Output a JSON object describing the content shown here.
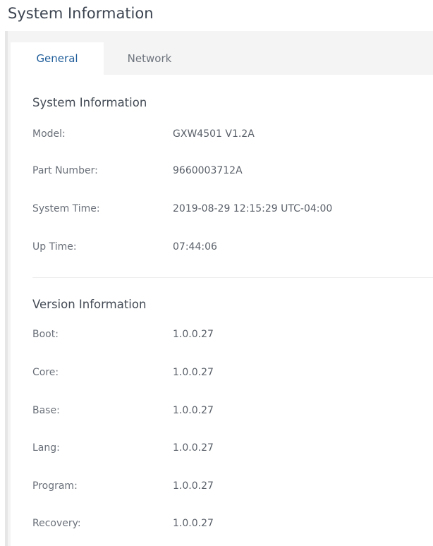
{
  "page": {
    "title": "System Information"
  },
  "tabs": [
    {
      "label": "General"
    },
    {
      "label": "Network"
    }
  ],
  "system_info": {
    "title": "System Information",
    "rows": [
      {
        "label": "Model:",
        "value": "GXW4501 V1.2A"
      },
      {
        "label": "Part Number:",
        "value": "9660003712A"
      },
      {
        "label": "System Time:",
        "value": "2019-08-29 12:15:29 UTC-04:00"
      },
      {
        "label": "Up Time:",
        "value": "07:44:06"
      }
    ]
  },
  "version_info": {
    "title": "Version Information",
    "rows": [
      {
        "label": "Boot:",
        "value": "1.0.0.27"
      },
      {
        "label": "Core:",
        "value": "1.0.0.27"
      },
      {
        "label": "Base:",
        "value": "1.0.0.27"
      },
      {
        "label": "Lang:",
        "value": "1.0.0.27"
      },
      {
        "label": "Program:",
        "value": "1.0.0.27"
      },
      {
        "label": "Recovery:",
        "value": "1.0.0.27"
      }
    ]
  }
}
